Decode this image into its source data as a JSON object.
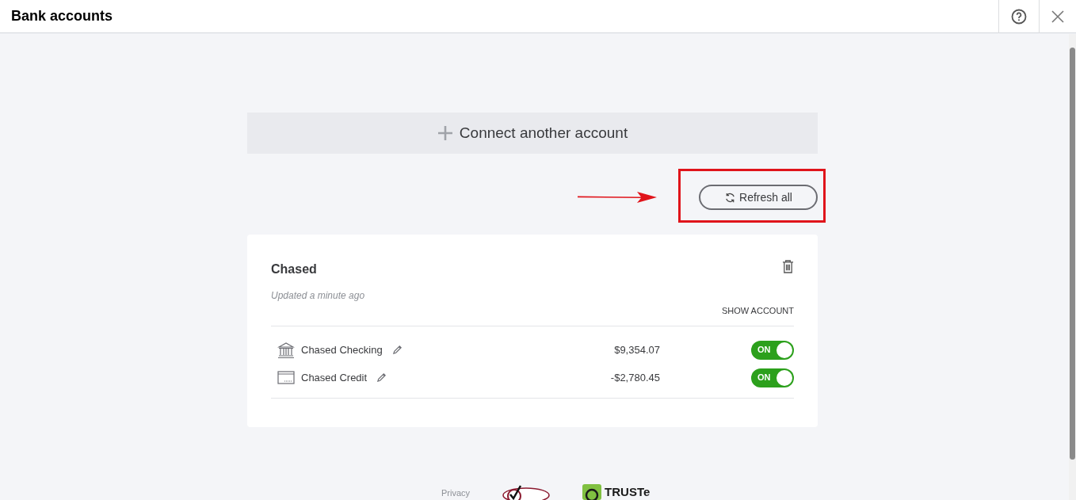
{
  "window": {
    "title": "Bank accounts"
  },
  "connect_button": {
    "label": "Connect another account"
  },
  "refresh_button": {
    "label": "Refresh all"
  },
  "banks": [
    {
      "name": "Chased",
      "updated": "Updated a minute ago",
      "show_account": "SHOW ACCOUNT",
      "accounts": [
        {
          "kind": "bank",
          "name": "Chased Checking",
          "amount": "$9,354.07",
          "on": true,
          "toggle_label": "ON"
        },
        {
          "kind": "card",
          "name": "Chased Credit",
          "amount": "-$2,780.45",
          "on": true,
          "toggle_label": "ON"
        }
      ]
    }
  ],
  "footer": {
    "privacy": "Privacy",
    "seal": "TRUSTe"
  }
}
